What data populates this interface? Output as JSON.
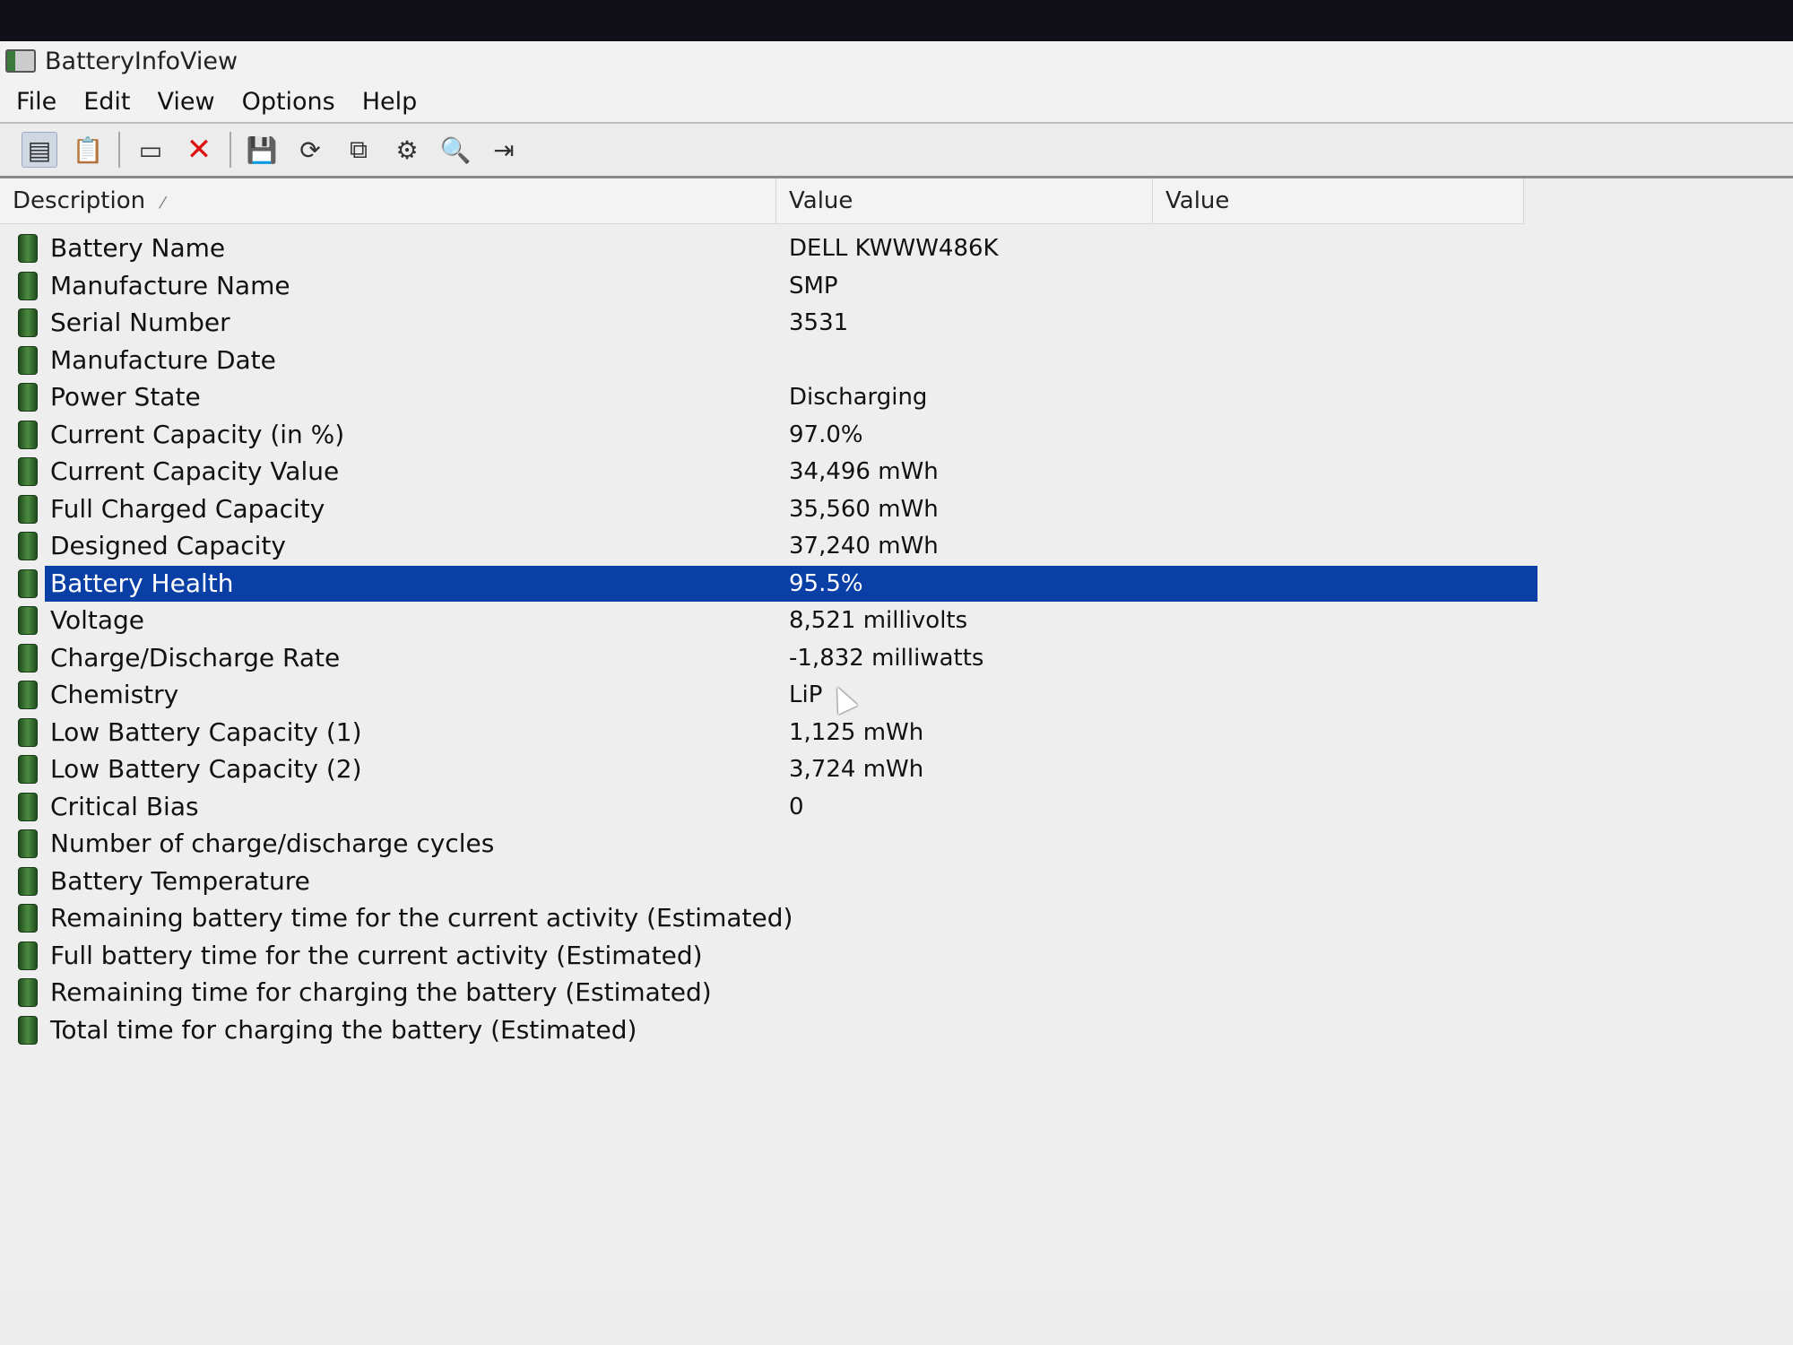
{
  "window": {
    "title": "BatteryInfoView"
  },
  "menu": [
    "File",
    "Edit",
    "View",
    "Options",
    "Help"
  ],
  "toolbar": {
    "icons": [
      "list-view-icon",
      "clipboard-icon",
      "properties-window-icon",
      "delete-icon",
      "save-icon",
      "refresh-icon",
      "copy-icon",
      "html-report-icon",
      "find-icon",
      "exit-icon"
    ],
    "glyphs": [
      "▤",
      "📋",
      "▭",
      "✕",
      "💾",
      "⟳",
      "⧉",
      "⚙",
      "🔍",
      "⇥"
    ]
  },
  "columns": [
    "Description",
    "Value",
    "Value"
  ],
  "rows": [
    {
      "desc": "Battery Name",
      "value": "DELL KWWW486K"
    },
    {
      "desc": "Manufacture Name",
      "value": "SMP"
    },
    {
      "desc": "Serial Number",
      "value": "3531"
    },
    {
      "desc": "Manufacture Date",
      "value": ""
    },
    {
      "desc": "Power State",
      "value": "Discharging"
    },
    {
      "desc": "Current Capacity (in %)",
      "value": "97.0%"
    },
    {
      "desc": "Current Capacity Value",
      "value": "34,496 mWh"
    },
    {
      "desc": "Full Charged Capacity",
      "value": "35,560 mWh"
    },
    {
      "desc": "Designed Capacity",
      "value": "37,240 mWh"
    },
    {
      "desc": "Battery Health",
      "value": "95.5%",
      "selected": true
    },
    {
      "desc": "Voltage",
      "value": "8,521 millivolts"
    },
    {
      "desc": "Charge/Discharge Rate",
      "value": "-1,832 milliwatts"
    },
    {
      "desc": "Chemistry",
      "value": "LiP"
    },
    {
      "desc": "Low Battery Capacity (1)",
      "value": "1,125 mWh"
    },
    {
      "desc": "Low Battery Capacity (2)",
      "value": "3,724 mWh"
    },
    {
      "desc": "Critical Bias",
      "value": "0"
    },
    {
      "desc": "Number of charge/discharge cycles",
      "value": ""
    },
    {
      "desc": "Battery Temperature",
      "value": ""
    },
    {
      "desc": "Remaining battery time for the current activity (Estimated)",
      "value": ""
    },
    {
      "desc": "Full battery time for the current activity (Estimated)",
      "value": ""
    },
    {
      "desc": "Remaining time for charging the battery (Estimated)",
      "value": ""
    },
    {
      "desc": "Total  time for charging the battery (Estimated)",
      "value": ""
    }
  ]
}
